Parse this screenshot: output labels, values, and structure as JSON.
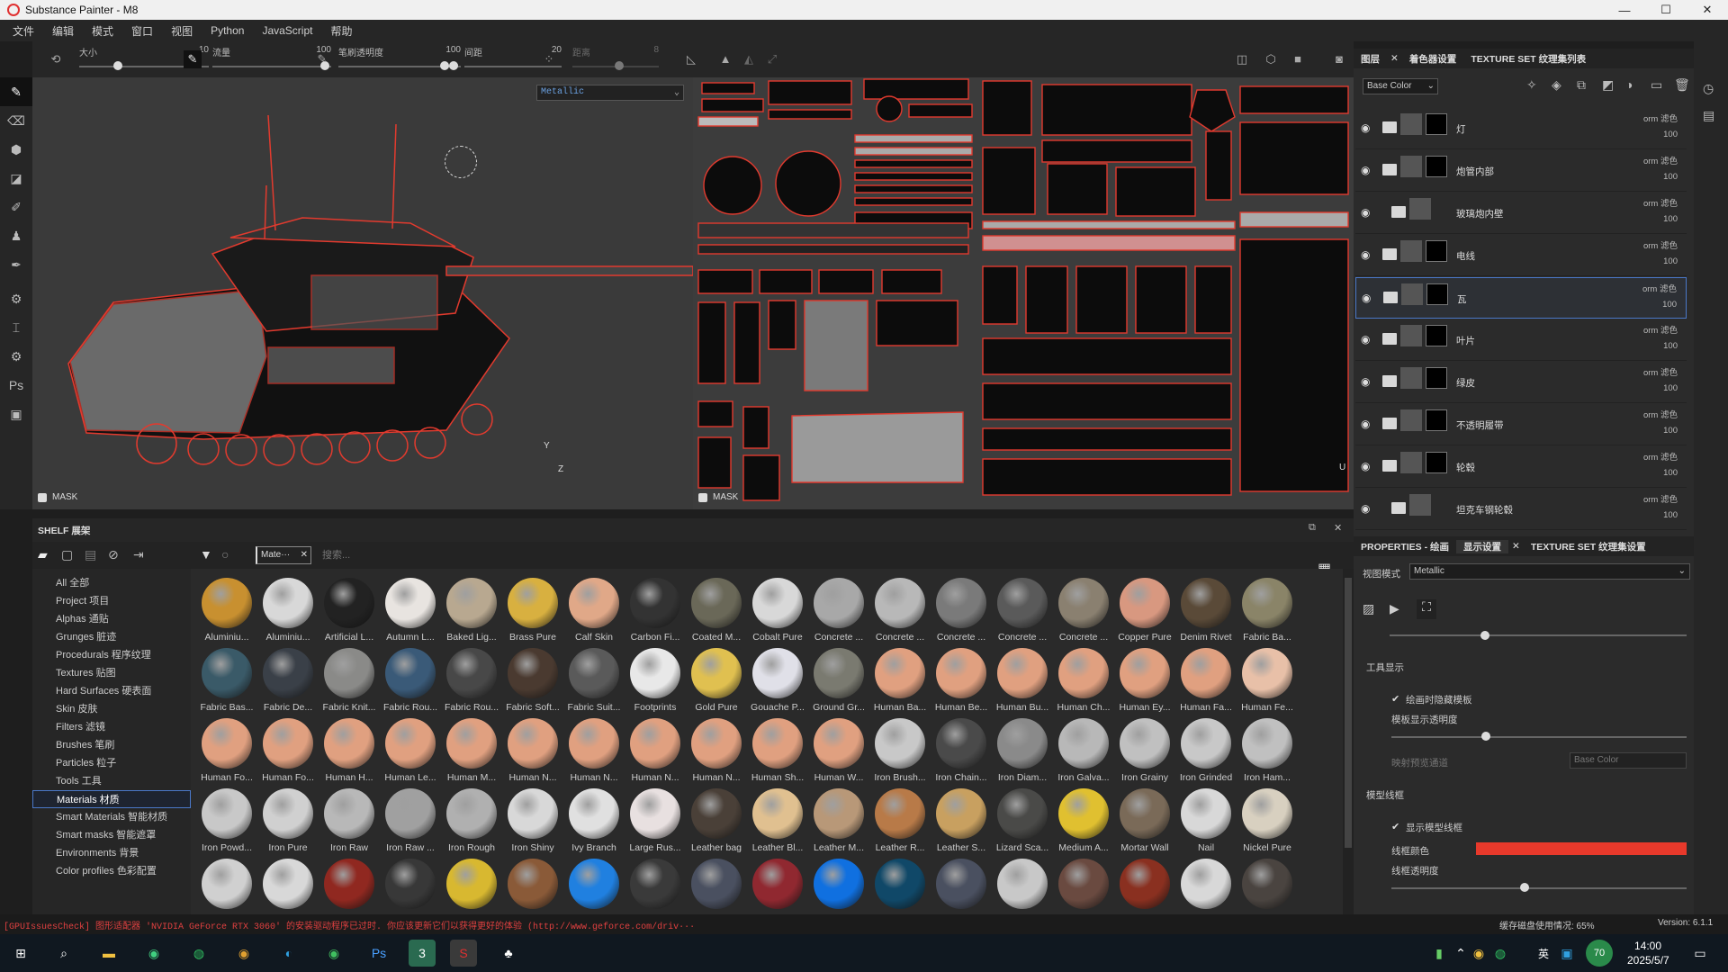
{
  "window": {
    "title": "Substance Painter - M8",
    "controls": [
      "—",
      "☐",
      "✕"
    ]
  },
  "menu": [
    "文件",
    "编辑",
    "模式",
    "窗口",
    "视图",
    "Python",
    "JavaScript",
    "帮助"
  ],
  "toolbar": {
    "size_label": "大小",
    "size_value": "10",
    "size_level": 0.28,
    "flow_label": "流量",
    "flow_value": "100",
    "flow_level": 0.98,
    "stroke_opacity_label": "笔刷透明度",
    "stroke_opacity_value": "100",
    "stroke_opacity_level": 0.98,
    "spacing_label": "间距",
    "spacing_value": "20",
    "spacing_level": 0.02,
    "jitter_label": "距离",
    "jitter_value": "8",
    "jitter_level": 0.55
  },
  "viewport": {
    "channel_select": "Metallic",
    "mask_label": "MASK",
    "axis_y": "Y",
    "axis_z": "Z",
    "axis_u": "U"
  },
  "right_tabs": {
    "layers": "图层",
    "shader": "着色器设置",
    "texset": "TEXTURE SET 纹理集列表"
  },
  "layers": {
    "channel": "Base Color",
    "items": [
      {
        "name": "灯",
        "blend": "orm 滤色",
        "opacity": "100"
      },
      {
        "name": "炮管内部",
        "blend": "orm 滤色",
        "opacity": "100"
      },
      {
        "name": "玻璃炮内壁",
        "blend": "orm 滤色",
        "opacity": "100"
      },
      {
        "name": "电线",
        "blend": "orm 滤色",
        "opacity": "100"
      },
      {
        "name": "瓦",
        "blend": "orm 滤色",
        "opacity": "100",
        "selected": true
      },
      {
        "name": "叶片",
        "blend": "orm 滤色",
        "opacity": "100"
      },
      {
        "name": "绿皮",
        "blend": "orm 滤色",
        "opacity": "100"
      },
      {
        "name": "不透明履带",
        "blend": "orm 滤色",
        "opacity": "100"
      },
      {
        "name": "轮毂",
        "blend": "orm 滤色",
        "opacity": "100"
      },
      {
        "name": "坦克车钢轮毂",
        "blend": "orm 滤色",
        "opacity": "100"
      }
    ]
  },
  "props": {
    "tabs": {
      "props": "PROPERTIES - 绘画",
      "display": "显示设置",
      "texset": "TEXTURE SET 纹理集设置"
    },
    "view_mode_label": "视图模式",
    "view_mode_value": "Metallic",
    "tool_display": "工具显示",
    "hide_when_paint": "绘画时隐藏模板",
    "stencil_opacity": "模板显示透明度",
    "map_channel_label": "映射预览通道",
    "map_channel_value": "Base Color",
    "wire_title": "模型线框",
    "show_wire": "显示模型线框",
    "wire_color_label": "线框颜色",
    "wire_color": "#e8392b",
    "wire_opacity": "线框透明度",
    "top_slider_level": 0.32,
    "stencil_opacity_level": 0.32,
    "wire_opacity_level": 0.45
  },
  "shelf": {
    "title": "SHELF 展架",
    "filter_chip": "Mate···",
    "search_placeholder": "搜索...",
    "categories": [
      "All 全部",
      "Project 项目",
      "Alphas 通贴",
      "Grunges 脏迹",
      "Procedurals 程序纹理",
      "Textures 贴图",
      "Hard Surfaces 硬表面",
      "Skin 皮肤",
      "Filters 滤镜",
      "Brushes 笔刷",
      "Particles 粒子",
      "Tools 工具",
      "Materials 材质",
      "Smart Materials 智能材质",
      "Smart masks 智能遮罩",
      "Environments 背景",
      "Color profiles 色彩配置"
    ],
    "selected_category": "Materials 材质",
    "materials": [
      {
        "name": "Aluminiu...",
        "color": "#c89030"
      },
      {
        "name": "Aluminiu...",
        "color": "#d8d8d8"
      },
      {
        "name": "Artificial L...",
        "color": "#222222"
      },
      {
        "name": "Autumn L...",
        "color": "#e8e4e0"
      },
      {
        "name": "Baked Lig...",
        "color": "#b8a890"
      },
      {
        "name": "Brass Pure",
        "color": "#d8b040"
      },
      {
        "name": "Calf Skin",
        "color": "#e0a888"
      },
      {
        "name": "Carbon Fi...",
        "color": "#333333"
      },
      {
        "name": "Coated M...",
        "color": "#6a6858"
      },
      {
        "name": "Cobalt Pure",
        "color": "#d8d8d8"
      },
      {
        "name": "Concrete ...",
        "color": "#a8a8a8"
      },
      {
        "name": "Concrete ...",
        "color": "#b8b8b8"
      },
      {
        "name": "Concrete ...",
        "color": "#7a7a7a"
      },
      {
        "name": "Concrete ...",
        "color": "#5a5a5a"
      },
      {
        "name": "Concrete ...",
        "color": "#8a8070"
      },
      {
        "name": "Copper Pure",
        "color": "#d89880"
      },
      {
        "name": "Denim Rivet",
        "color": "#5a4a38"
      },
      {
        "name": "Fabric Ba...",
        "color": "#8a8468"
      },
      {
        "name": "Fabric Bas...",
        "color": "#3a5a68"
      },
      {
        "name": "Fabric De...",
        "color": "#3a4048"
      },
      {
        "name": "Fabric Knit...",
        "color": "#8a8a88"
      },
      {
        "name": "Fabric Rou...",
        "color": "#3a5a78"
      },
      {
        "name": "Fabric Rou...",
        "color": "#484848"
      },
      {
        "name": "Fabric Soft...",
        "color": "#4a3a30"
      },
      {
        "name": "Fabric Suit...",
        "color": "#5a5a5a"
      },
      {
        "name": "Footprints",
        "color": "#e8e8e8"
      },
      {
        "name": "Gold Pure",
        "color": "#e0c050"
      },
      {
        "name": "Gouache P...",
        "color": "#e0e0e8"
      },
      {
        "name": "Ground Gr...",
        "color": "#7a7a70"
      },
      {
        "name": "Human Ba...",
        "color": "#e0a080"
      },
      {
        "name": "Human Be...",
        "color": "#e0a080"
      },
      {
        "name": "Human Bu...",
        "color": "#e0a080"
      },
      {
        "name": "Human Ch...",
        "color": "#e0a080"
      },
      {
        "name": "Human Ey...",
        "color": "#e0a080"
      },
      {
        "name": "Human Fa...",
        "color": "#e0a080"
      },
      {
        "name": "Human Fe...",
        "color": "#e8c0a8"
      },
      {
        "name": "Human Fo...",
        "color": "#e0a080"
      },
      {
        "name": "Human Fo...",
        "color": "#e0a080"
      },
      {
        "name": "Human H...",
        "color": "#e0a080"
      },
      {
        "name": "Human Le...",
        "color": "#e0a080"
      },
      {
        "name": "Human M...",
        "color": "#e0a080"
      },
      {
        "name": "Human N...",
        "color": "#e0a080"
      },
      {
        "name": "Human N...",
        "color": "#e0a080"
      },
      {
        "name": "Human N...",
        "color": "#e0a080"
      },
      {
        "name": "Human N...",
        "color": "#e0a080"
      },
      {
        "name": "Human Sh...",
        "color": "#e0a080"
      },
      {
        "name": "Human W...",
        "color": "#e0a080"
      },
      {
        "name": "Iron Brush...",
        "color": "#c8c8c8"
      },
      {
        "name": "Iron Chain...",
        "color": "#4a4a4a"
      },
      {
        "name": "Iron Diam...",
        "color": "#8a8a8a"
      },
      {
        "name": "Iron Galva...",
        "color": "#b8b8b8"
      },
      {
        "name": "Iron Grainy",
        "color": "#c0c0c0"
      },
      {
        "name": "Iron Grinded",
        "color": "#c8c8c8"
      },
      {
        "name": "Iron Ham...",
        "color": "#c0c0c0"
      },
      {
        "name": "Iron Powd...",
        "color": "#c8c8c8"
      },
      {
        "name": "Iron Pure",
        "color": "#d0d0d0"
      },
      {
        "name": "Iron Raw",
        "color": "#b8b8b8"
      },
      {
        "name": "Iron Raw ...",
        "color": "#a0a0a0"
      },
      {
        "name": "Iron Rough",
        "color": "#b0b0b0"
      },
      {
        "name": "Iron Shiny",
        "color": "#d8d8d8"
      },
      {
        "name": "Ivy Branch",
        "color": "#e0e0e0"
      },
      {
        "name": "Large Rus...",
        "color": "#e8e0e0"
      },
      {
        "name": "Leather bag",
        "color": "#4a4038"
      },
      {
        "name": "Leather Bl...",
        "color": "#e0c090"
      },
      {
        "name": "Leather M...",
        "color": "#b89878"
      },
      {
        "name": "Leather R...",
        "color": "#b87a48"
      },
      {
        "name": "Leather S...",
        "color": "#c8a060"
      },
      {
        "name": "Lizard Sca...",
        "color": "#4a4a48"
      },
      {
        "name": "Medium A...",
        "color": "#e0c030"
      },
      {
        "name": "Mortar Wall",
        "color": "#7a6a58"
      },
      {
        "name": "Nail",
        "color": "#d8d8d8"
      },
      {
        "name": "Nickel Pure",
        "color": "#d8d0c0"
      },
      {
        "name": "",
        "color": "#d0d0d0"
      },
      {
        "name": "",
        "color": "#d8d8d8"
      },
      {
        "name": "",
        "color": "#902820"
      },
      {
        "name": "",
        "color": "#383838"
      },
      {
        "name": "",
        "color": "#d8b830"
      },
      {
        "name": "",
        "color": "#8a5a38"
      },
      {
        "name": "",
        "color": "#2080e0"
      },
      {
        "name": "",
        "color": "#3a3a3a"
      },
      {
        "name": "",
        "color": "#4a5060"
      },
      {
        "name": "",
        "color": "#902830"
      },
      {
        "name": "",
        "color": "#1070e0"
      },
      {
        "name": "",
        "color": "#104868"
      },
      {
        "name": "",
        "color": "#4a5060"
      },
      {
        "name": "",
        "color": "#c8c8c8"
      },
      {
        "name": "",
        "color": "#6a4a40"
      },
      {
        "name": "",
        "color": "#8a3020"
      },
      {
        "name": "",
        "color": "#d8d8d8"
      },
      {
        "name": "",
        "color": "#4a4440"
      }
    ]
  },
  "status": {
    "message": "[GPUIssuesCheck] 图形适配器 'NVIDIA GeForce RTX 3060' 的安装驱动程序已过时. 你应该更新它们以获得更好的体验 (http://www.geforce.com/driv···",
    "disk": "缓存磁盘使用情况: 65%",
    "version": "Version: 6.1.1"
  },
  "taskbar": {
    "time": "14:00",
    "date": "2025/5/7",
    "ime": "英",
    "badge": "70"
  },
  "colors": {
    "accent_select": "#4a78c8",
    "wire_red": "#e8392b"
  }
}
